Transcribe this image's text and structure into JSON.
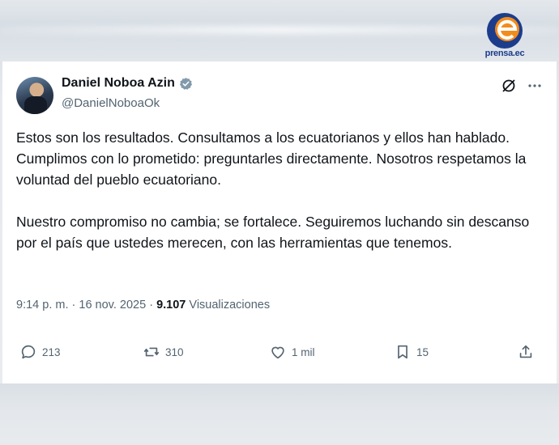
{
  "watermark": {
    "logo_text": "prensa.ec"
  },
  "tweet": {
    "author_name": "Daniel Noboa Azin",
    "handle": "@DanielNoboaOk",
    "paragraph_1": "Estos son los resultados. Consultamos a los ecuatorianos y ellos han hablado. Cumplimos con lo prometido: preguntarles directamente. Nosotros respetamos la voluntad del pueblo ecuatoriano.",
    "paragraph_2": "Nuestro compromiso no cambia; se fortalece. Seguiremos luchando sin descanso por el país que ustedes merecen, con las herramientas que tenemos.",
    "time": "9:14 p. m.",
    "separator": "·",
    "date": "16 nov. 2025",
    "views_count": "9.107",
    "views_label": "Visualizaciones"
  },
  "actions": {
    "replies": "213",
    "reposts": "310",
    "likes": "1 mil",
    "bookmarks": "15"
  },
  "icons": [
    "verified-badge-icon",
    "grok-icon",
    "more-icon",
    "reply-icon",
    "repost-icon",
    "like-icon",
    "bookmark-icon",
    "share-icon"
  ],
  "colors": {
    "verified": "#829aab",
    "text": "#0f1419",
    "muted": "#536471",
    "logo_blue": "#1c3d8c",
    "logo_orange": "#f28c1c"
  }
}
